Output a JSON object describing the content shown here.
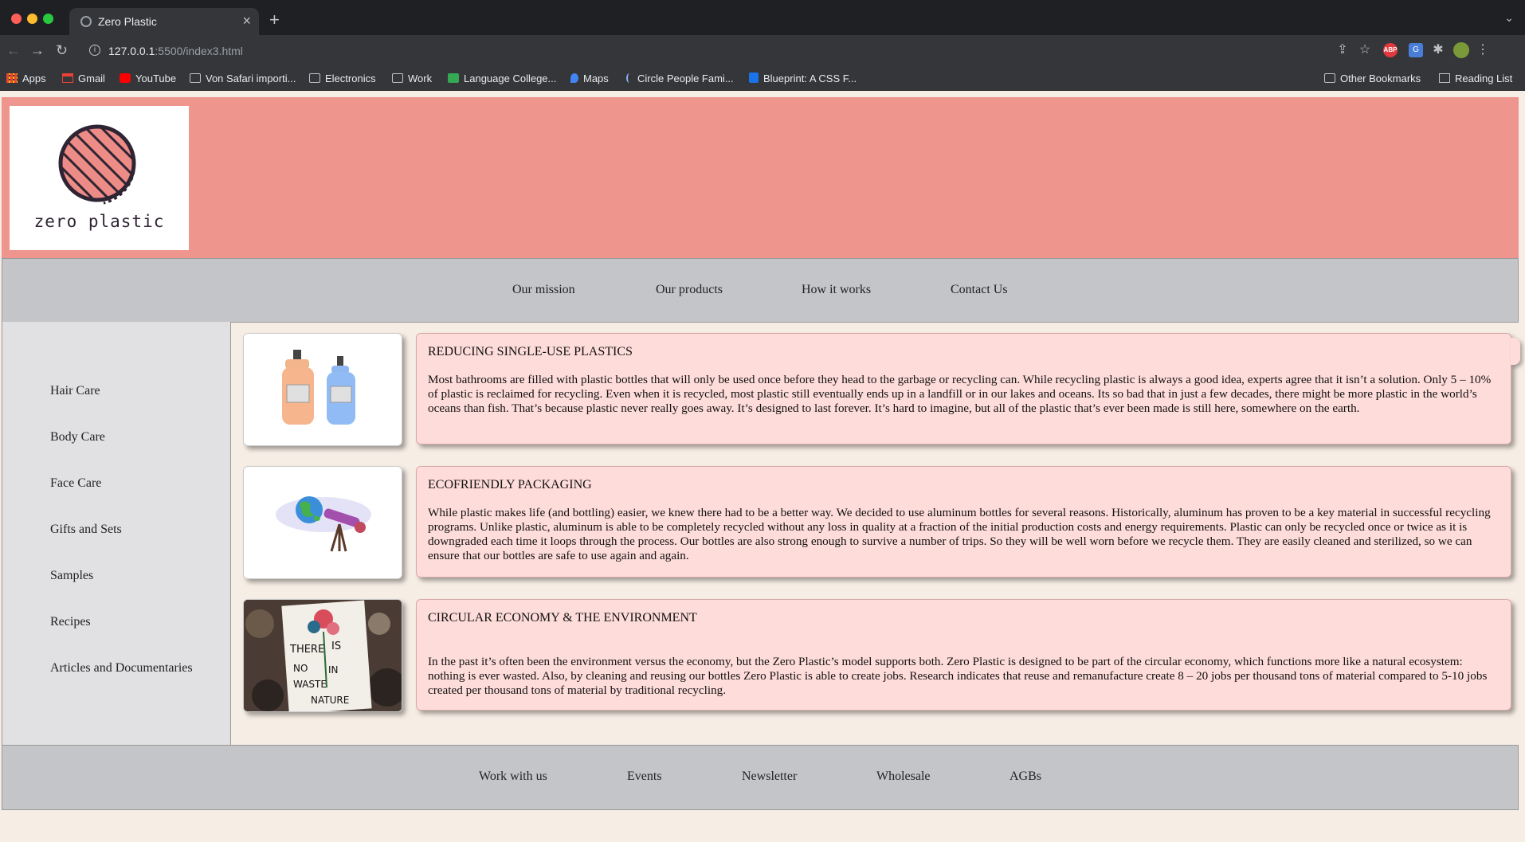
{
  "browser": {
    "tab_title": "Zero Plastic",
    "url_host": "127.0.0.1",
    "url_path": ":5500/index3.html",
    "bookmarks": [
      "Apps",
      "Gmail",
      "YouTube",
      "Von Safari importi...",
      "Electronics",
      "Work",
      "Language College...",
      "Maps",
      "Circle People Fami...",
      "Blueprint: A CSS F..."
    ],
    "other_bookmarks": "Other Bookmarks",
    "reading_list": "Reading List"
  },
  "header": {
    "logo_text": "zero plastic",
    "logo_colors": {
      "fill": "#ed8c86",
      "ink": "#2f2433"
    },
    "background": "#ee958e"
  },
  "nav": {
    "items": [
      "Our mission",
      "Our products",
      "How it works",
      "Contact Us"
    ]
  },
  "sidebar": {
    "items": [
      "Hair Care",
      "Body Care",
      "Face Care",
      "Gifts and Sets",
      "Samples",
      "Recipes",
      "Articles and Documentaries"
    ]
  },
  "cards": [
    {
      "image_icon": "shampoo-bottles-icon",
      "title": "REDUCING SINGLE-USE PLASTICS",
      "body": "Most bathrooms are filled with plastic bottles that will only be used once before they head to the garbage or recycling can. While recycling plastic is always a good idea, experts agree that it isn’t a solution. Only 5 – 10% of plastic is reclaimed for recycling. Even when it is recycled, most plastic still eventually ends up in a landfill or in our lakes and oceans. Its so bad that in just a few decades, there might be more plastic in the world’s oceans than fish. That’s because plastic never really goes away. It’s designed to last forever. It’s hard to imagine, but all of the plastic that’s ever been made is still here, somewhere on the earth."
    },
    {
      "image_icon": "globe-telescope-icon",
      "title": "ECOFRIENDLY PACKAGING",
      "body": "While plastic makes life (and bottling) easier, we knew there had to be a better way. We decided to use aluminum bottles for several reasons. Historically, aluminum has proven to be a key material in successful recycling programs. Unlike plastic, aluminum is able to be completely recycled without any loss in quality at a fraction of the initial production costs and energy requirements. Plastic can only be recycled once or twice as it is downgraded each time it loops through the process. Our bottles are also strong enough to survive a number of trips. So they will be well worn before we recycle them. They are easily cleaned and sterilized, so we can ensure that our bottles are safe to use again and again."
    },
    {
      "image_icon": "protest-sign-photo",
      "image_sign_text": "THERE IS NO WASTE IN NATURE",
      "title": "CIRCULAR ECONOMY & THE ENVIRONMENT",
      "body": "In the past it’s often been the environment versus the economy, but the Zero Plastic’s model supports both. Zero Plastic is designed to be part of the circular economy, which functions more like a natural ecosystem: nothing is ever wasted. Also, by cleaning and reusing our bottles Zero Plastic is able to create jobs. Research indicates that reuse and remanufacture create 8 – 20 jobs per thousand tons of material compared to 5-10 jobs created per thousand tons of material by traditional recycling."
    }
  ],
  "footer": {
    "items": [
      "Work with us",
      "Events",
      "Newsletter",
      "Wholesale",
      "AGBs"
    ]
  },
  "colors": {
    "page_bg": "#f6ede4",
    "nav_bg": "#c4c5c8",
    "sidebar_bg": "#e1e1e3",
    "card_bg": "#fedcda"
  }
}
